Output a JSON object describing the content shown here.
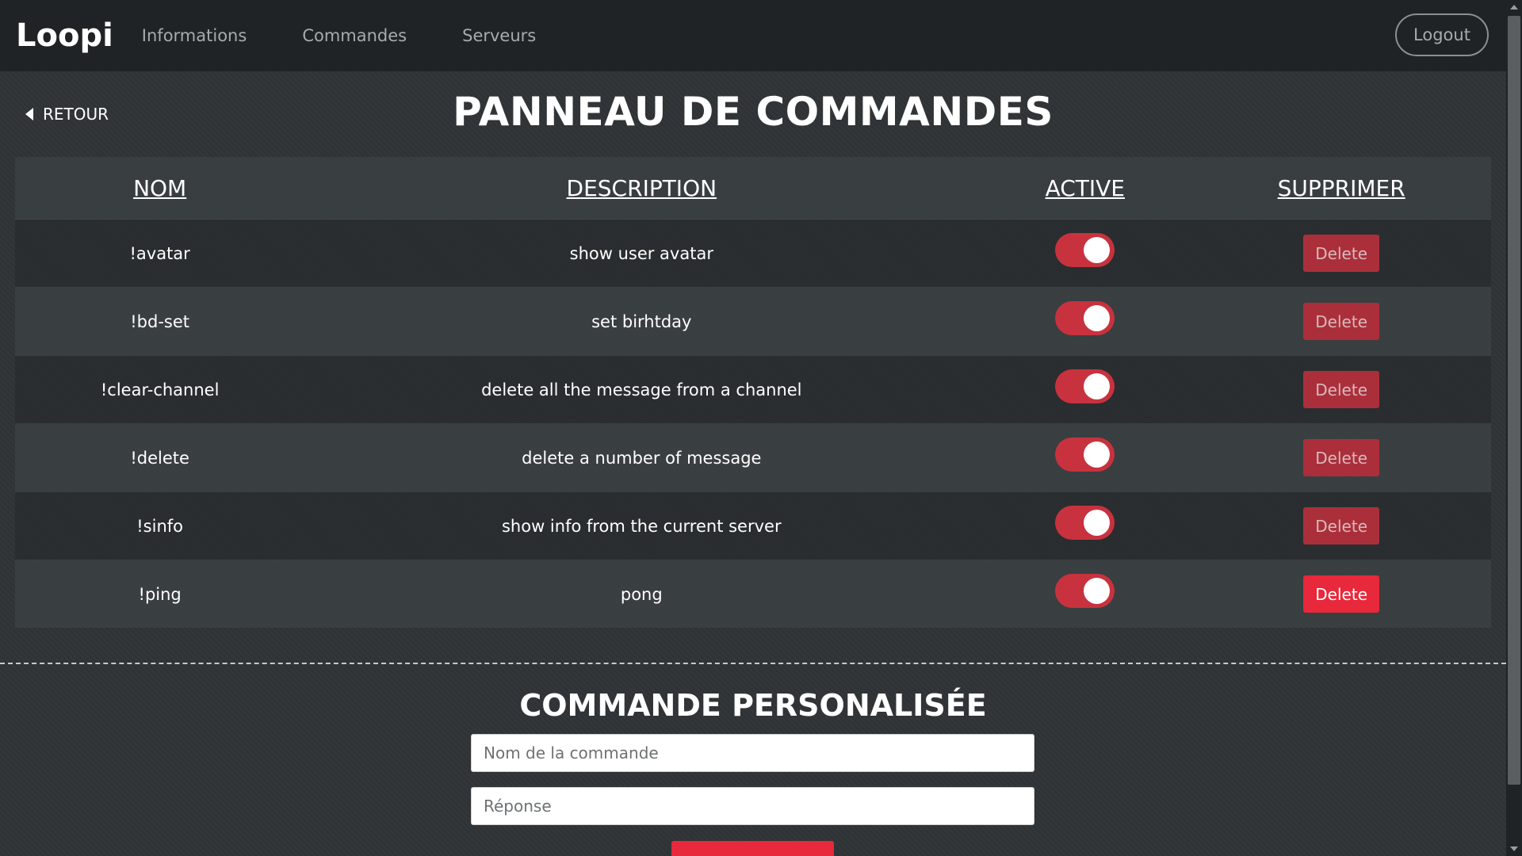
{
  "navbar": {
    "brand": "Loopi",
    "links": [
      "Informations",
      "Commandes",
      "Serveurs"
    ],
    "logout_label": "Logout"
  },
  "header": {
    "back_label": "RETOUR",
    "title": "PANNEAU DE COMMANDES"
  },
  "table": {
    "columns": [
      "NOM",
      "DESCRIPTION",
      "ACTIVE",
      "SUPPRIMER"
    ],
    "rows": [
      {
        "name": "!avatar",
        "description": "show user avatar",
        "active": true,
        "delete_label": "Delete"
      },
      {
        "name": "!bd-set",
        "description": "set birhtday",
        "active": true,
        "delete_label": "Delete"
      },
      {
        "name": "!clear-channel",
        "description": "delete all the message from a channel",
        "active": true,
        "delete_label": "Delete"
      },
      {
        "name": "!delete",
        "description": "delete a number of message",
        "active": true,
        "delete_label": "Delete"
      },
      {
        "name": "!sinfo",
        "description": "show info from the current server",
        "active": true,
        "delete_label": "Delete"
      },
      {
        "name": "!ping",
        "description": "pong",
        "active": true,
        "delete_label": "Delete"
      }
    ]
  },
  "custom_command": {
    "title": "COMMANDE PERSONALISÉE",
    "name_placeholder": "Nom de la commande",
    "response_placeholder": "Réponse",
    "name_value": "",
    "response_value": ""
  },
  "colors": {
    "accent": "#e8283b",
    "toggle_on": "#c8323e",
    "navbar_bg": "#202325",
    "page_bg": "#2f3335"
  }
}
